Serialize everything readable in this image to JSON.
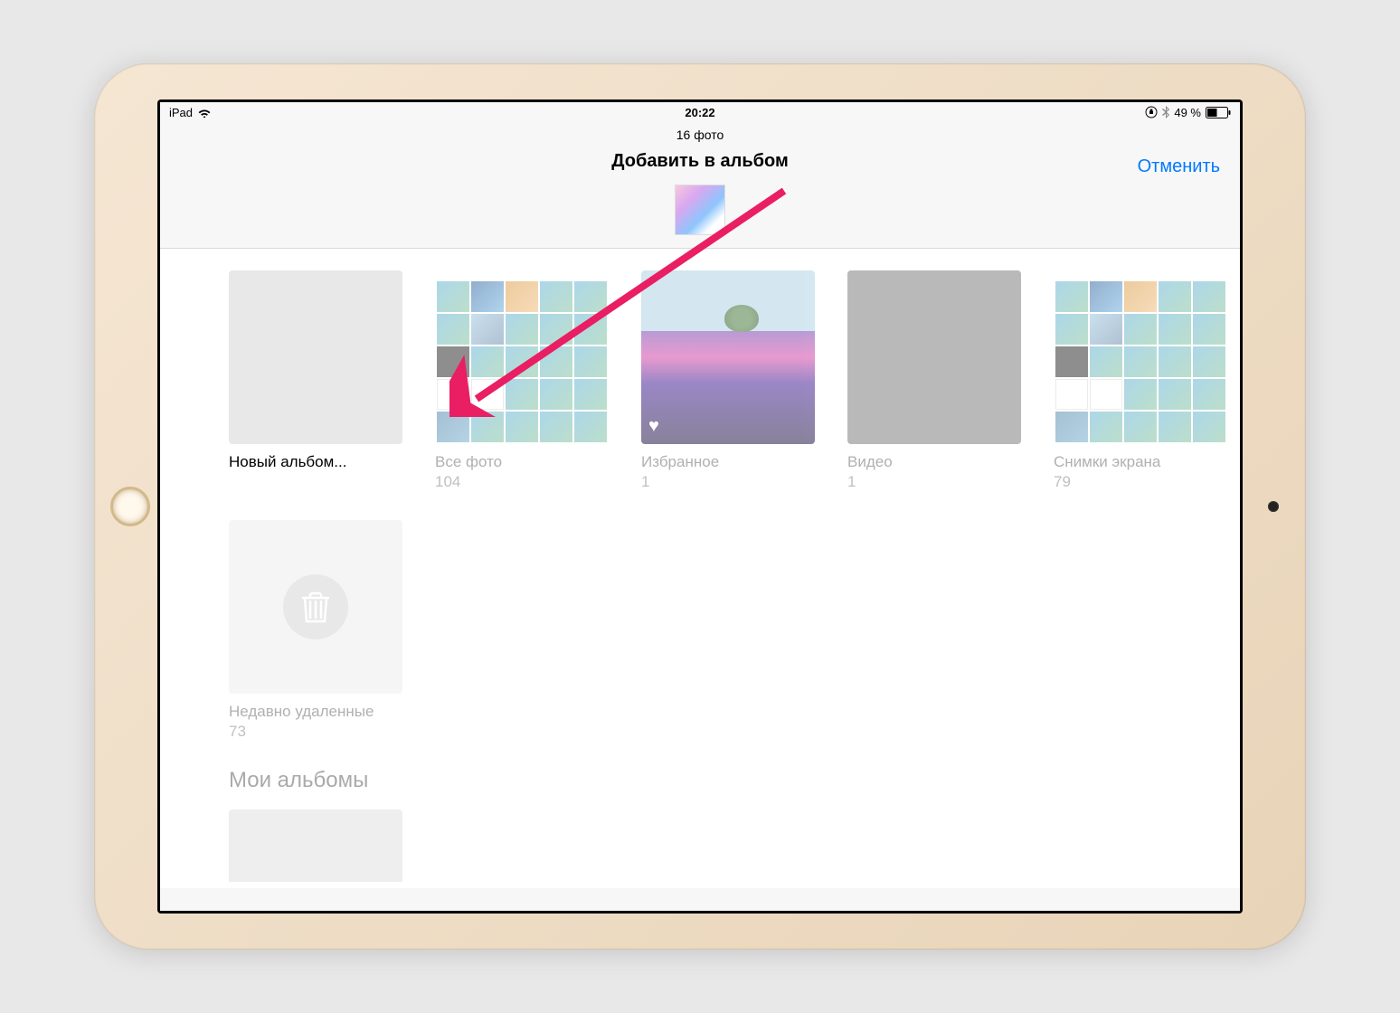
{
  "status": {
    "device": "iPad",
    "time": "20:22",
    "battery_text": "49 %"
  },
  "header": {
    "photo_count": "16 фото",
    "title": "Добавить в альбом",
    "cancel": "Отменить"
  },
  "albums": {
    "row1": [
      {
        "name": "Новый альбом...",
        "count": "",
        "active": true,
        "type": "empty"
      },
      {
        "name": "Все фото",
        "count": "104",
        "active": false,
        "type": "collage"
      },
      {
        "name": "Избранное",
        "count": "1",
        "active": false,
        "type": "lavender"
      },
      {
        "name": "Видео",
        "count": "1",
        "active": false,
        "type": "video"
      },
      {
        "name": "Снимки экрана",
        "count": "79",
        "active": false,
        "type": "collage"
      }
    ],
    "row2": [
      {
        "name": "Недавно удаленные",
        "count": "73",
        "active": false,
        "type": "trash"
      }
    ]
  },
  "section_title": "Мои альбомы"
}
